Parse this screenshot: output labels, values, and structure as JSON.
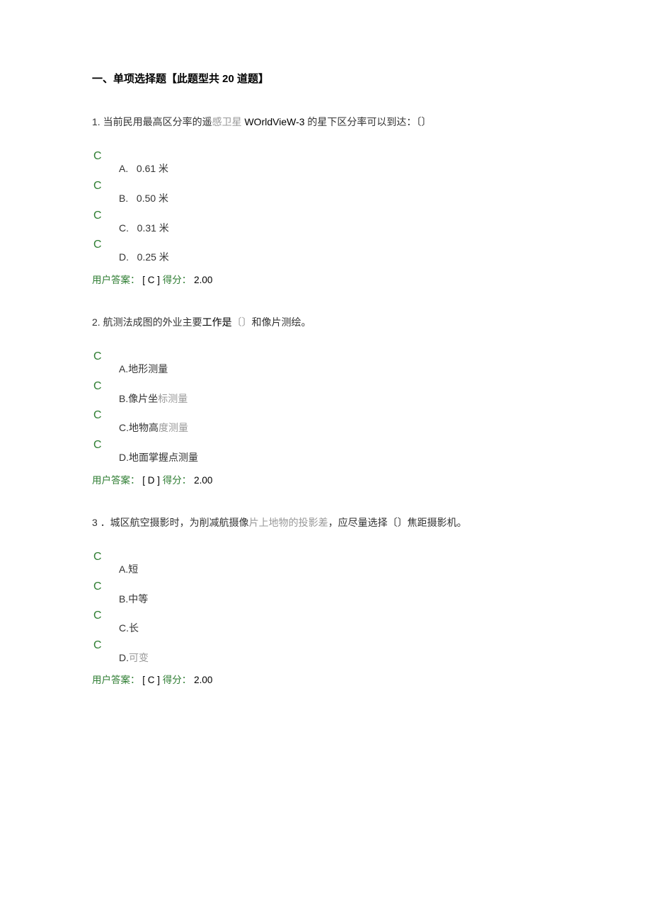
{
  "section_title": "一、单项选择题【此题型共 20 道题】",
  "questions": [
    {
      "number": "1.",
      "stem_pre": "当前民用最高区分率的遥",
      "stem_mid1": "感卫星",
      "stem_link": " WOrldVieW-3 ",
      "stem_post": "的星下区分率可以到达：〔〕",
      "options": [
        {
          "letter": "A.",
          "text_pre": "0.61 米",
          "text_muted": ""
        },
        {
          "letter": "B.",
          "text_pre": "0.50 米",
          "text_muted": ""
        },
        {
          "letter": "C.",
          "text_pre": "0.31 米",
          "text_muted": ""
        },
        {
          "letter": "D.",
          "text_pre": "0.25 米",
          "text_muted": ""
        }
      ],
      "answer_label": "用户答案：",
      "answer_value": "[ C ]",
      "score_label": "得分：",
      "score_value": "2.00"
    },
    {
      "number": "2.",
      "stem_pre": "航测法成图的外业主要",
      "stem_mid1": "工作是",
      "stem_link": "〔〕",
      "stem_post": "和像片测绘。",
      "options": [
        {
          "letter": "A.",
          "text_pre": "地形测量",
          "text_muted": ""
        },
        {
          "letter": "B.",
          "text_pre": "像片坐",
          "text_muted": "标测量"
        },
        {
          "letter": "C.",
          "text_pre": "地物高",
          "text_muted": "度测量"
        },
        {
          "letter": "D.",
          "text_pre": "地面掌握点测量",
          "text_muted": ""
        }
      ],
      "answer_label": "用户答案：",
      "answer_value": "[ D ]",
      "score_label": "得分：",
      "score_value": "2.00"
    },
    {
      "number": "3",
      "stem_pre": "．城区航空摄影时，为削减航摄像",
      "stem_mid1": "片上地物的投",
      "stem_link": "影差",
      "stem_post": "，应尽量选择〔〕焦距摄影机。",
      "options": [
        {
          "letter": "A.",
          "text_pre": "短",
          "text_muted": ""
        },
        {
          "letter": "B.",
          "text_pre": "中等",
          "text_muted": ""
        },
        {
          "letter": "C.",
          "text_pre": "长",
          "text_muted": ""
        },
        {
          "letter": "D.",
          "text_pre": "",
          "text_muted": "可变"
        }
      ],
      "answer_label": "用户答案：",
      "answer_value": "[ C ]",
      "score_label": "得分：",
      "score_value": "2.00"
    }
  ]
}
